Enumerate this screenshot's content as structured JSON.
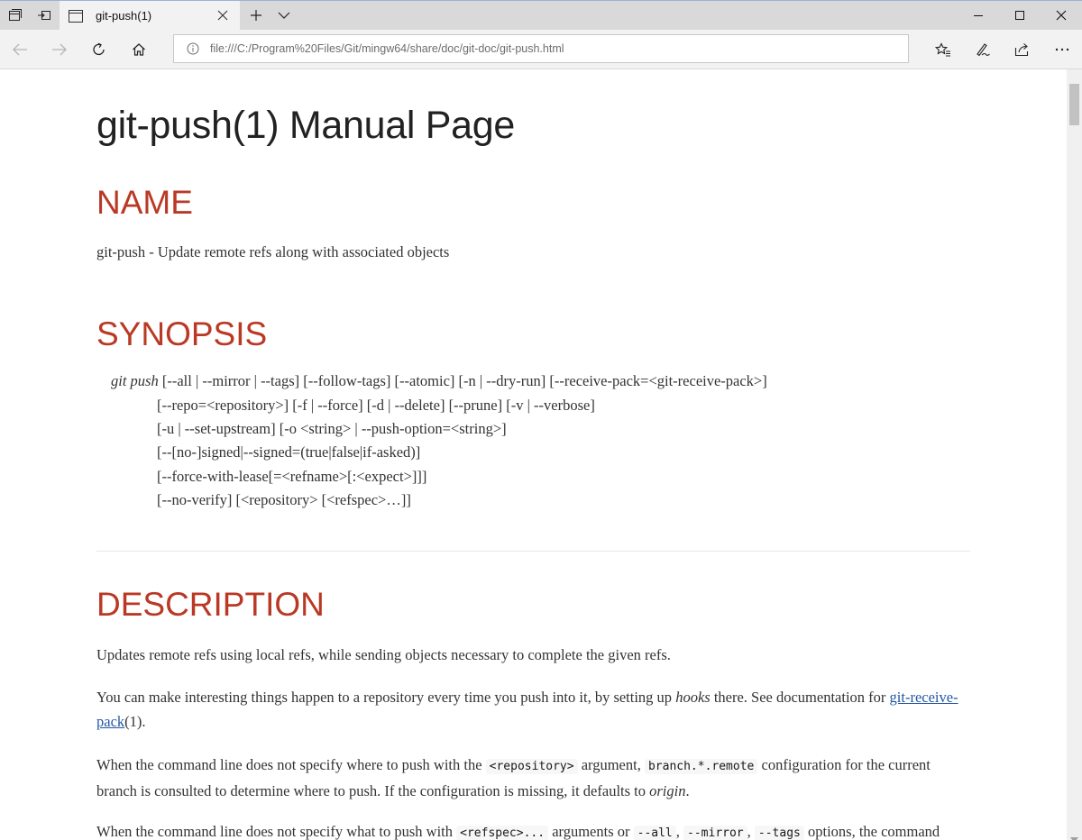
{
  "browser": {
    "tab_title": "git-push(1)",
    "url": "file:///C:/Program%20Files/Git/mingw64/share/doc/git-doc/git-push.html",
    "icons": [
      "tabs-aside-icon",
      "tab-page-icon",
      "close-icon",
      "new-tab-icon",
      "chevron-down-icon",
      "minimize-icon",
      "maximize-icon",
      "window-close-icon",
      "back-icon",
      "forward-icon",
      "refresh-icon",
      "home-icon",
      "info-icon",
      "favorites-icon",
      "pen-icon",
      "share-icon",
      "more-icon"
    ]
  },
  "doc": {
    "title": "git-push(1) Manual Page",
    "name_heading": "NAME",
    "name_text": "git-push - Update remote refs along with associated objects",
    "synopsis_heading": "SYNOPSIS",
    "synopsis_cmd": "git push",
    "synopsis_lines": [
      " [--all | --mirror | --tags] [--follow-tags] [--atomic] [-n | --dry-run] [--receive-pack=<git-receive-pack>]",
      "[--repo=<repository>] [-f | --force] [-d | --delete] [--prune] [-v | --verbose]",
      "[-u | --set-upstream] [-o <string> | --push-option=<string>]",
      "[--[no-]signed|--signed=(true|false|if-asked)]",
      "[--force-with-lease[=<refname>[:<expect>]]]",
      "[--no-verify] [<repository> [<refspec>…]]"
    ],
    "description_heading": "DESCRIPTION",
    "desc_p1": "Updates remote refs using local refs, while sending objects necessary to complete the given refs.",
    "desc_p2_a": "You can make interesting things happen to a repository every time you push into it, by setting up ",
    "desc_p2_em": "hooks",
    "desc_p2_b": " there. See documentation for ",
    "desc_p2_link1": "git-receive-",
    "desc_p2_link2": "pack",
    "desc_p2_c": "(1).",
    "desc_p3_a": "When the command line does not specify where to push with the ",
    "desc_p3_code1": "<repository>",
    "desc_p3_b": " argument, ",
    "desc_p3_code2": "branch.*.remote",
    "desc_p3_c": " configuration for the current branch is consulted to determine where to push. If the configuration is missing, it defaults to ",
    "desc_p3_em": "origin",
    "desc_p3_d": ".",
    "desc_p4_a": "When the command line does not specify what to push with ",
    "desc_p4_code1": "<refspec>...",
    "desc_p4_b": " arguments or ",
    "desc_p4_code2": "--all",
    "desc_p4_c": ", ",
    "desc_p4_code3": "--mirror",
    "desc_p4_d": ", ",
    "desc_p4_code4": "--tags",
    "desc_p4_e": " options, the command"
  }
}
